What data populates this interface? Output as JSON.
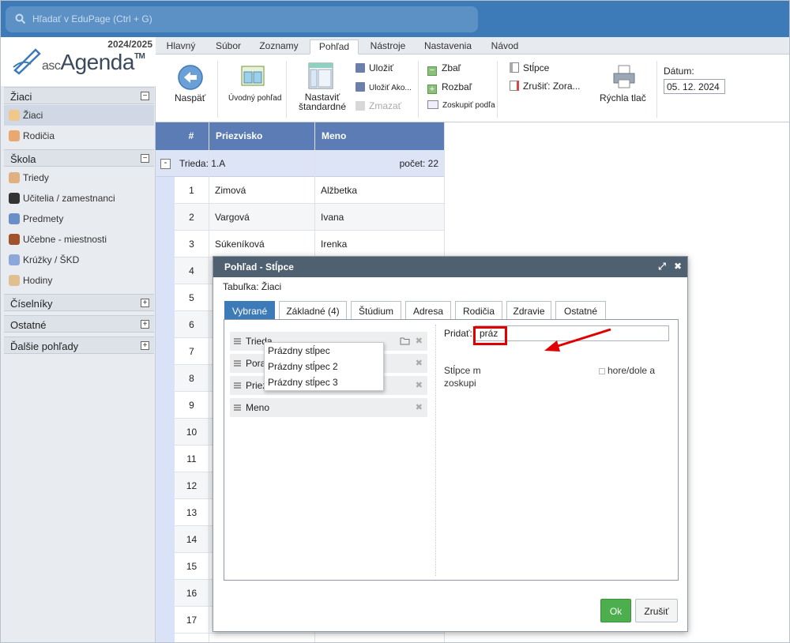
{
  "search": {
    "placeholder": "Hľadať v EduPage (Ctrl + G)"
  },
  "brand": {
    "year": "2024/2025",
    "prefix": "asc",
    "name": "Agenda",
    "tm": "TM"
  },
  "sidebar": {
    "sections": [
      {
        "label": "Žiaci",
        "toggle": "−"
      },
      {
        "label": "Škola",
        "toggle": "−"
      },
      {
        "label": "Číselníky",
        "toggle": "+"
      },
      {
        "label": "Ostatné",
        "toggle": "+"
      },
      {
        "label": "Ďalšie pohľady",
        "toggle": "+"
      }
    ],
    "items": [
      {
        "label": "Žiaci"
      },
      {
        "label": "Rodičia"
      },
      {
        "label": "Triedy"
      },
      {
        "label": "Učitelia / zamestnanci"
      },
      {
        "label": "Predmety"
      },
      {
        "label": "Učebne - miestnosti"
      },
      {
        "label": "Krúžky / ŠKD"
      },
      {
        "label": "Hodiny"
      }
    ]
  },
  "ribbon": {
    "tabs": [
      "Hlavný",
      "Súbor",
      "Zoznamy",
      "Pohľad",
      "Nástroje",
      "Nastavenia",
      "Návod"
    ],
    "back": "Naspäť",
    "intro_view": "Úvodný pohľad",
    "set_standard_1": "Nastaviť",
    "set_standard_2": "štandardné",
    "save": "Uložiť",
    "save_as": "Uložiť Ako...",
    "delete": "Zmazať",
    "collapse": "Zbaľ",
    "expand": "Rozbaľ",
    "group_by": "Zoskupiť podľa",
    "columns": "Stĺpce",
    "cancel_sort": "Zrušiť: Zora...",
    "quick_print": "Rýchla tlač",
    "date_label": "Dátum:",
    "date_value": "05. 12. 2024"
  },
  "grid": {
    "headers": {
      "num": "#",
      "surname": "Priezvisko",
      "name": "Meno"
    },
    "group": {
      "toggle": "-",
      "label": "Trieda: 1.A",
      "count": "počet: 22"
    },
    "rows": [
      {
        "num": "1",
        "surname": "Zimová",
        "name": "Alžbetka"
      },
      {
        "num": "2",
        "surname": "Vargová",
        "name": "Ivana"
      },
      {
        "num": "3",
        "surname": "Súkeníková",
        "name": "Irenka"
      },
      {
        "num": "4",
        "surname": "",
        "name": ""
      },
      {
        "num": "5",
        "surname": "",
        "name": ""
      },
      {
        "num": "6",
        "surname": "",
        "name": ""
      },
      {
        "num": "7",
        "surname": "",
        "name": ""
      },
      {
        "num": "8",
        "surname": "",
        "name": ""
      },
      {
        "num": "9",
        "surname": "",
        "name": ""
      },
      {
        "num": "10",
        "surname": "",
        "name": ""
      },
      {
        "num": "11",
        "surname": "",
        "name": ""
      },
      {
        "num": "12",
        "surname": "",
        "name": ""
      },
      {
        "num": "13",
        "surname": "",
        "name": ""
      },
      {
        "num": "14",
        "surname": "",
        "name": ""
      },
      {
        "num": "15",
        "surname": "",
        "name": ""
      },
      {
        "num": "16",
        "surname": "",
        "name": ""
      },
      {
        "num": "17",
        "surname": "",
        "name": ""
      }
    ]
  },
  "dialog": {
    "title": "Pohľad - Stĺpce",
    "subtitle": "Tabuľka: Žiaci",
    "tabs": [
      "Vybrané",
      "Základné (4)",
      "Štúdium",
      "Adresa",
      "Rodičia",
      "Zdravie",
      "Ostatné"
    ],
    "selected_columns": [
      "Trieda",
      "Poradové číslo",
      "Priezvisko",
      "Meno"
    ],
    "add_label": "Pridať:",
    "add_value": "práz",
    "hint_left_1": "Stĺpce m",
    "hint_left_2": "zoskupi",
    "hint_right_1": "hore/dole a",
    "suggestions": [
      "Prázdny stĺpec",
      "Prázdny stĺpec 2",
      "Prázdny stĺpec 3"
    ],
    "ok": "Ok",
    "cancel": "Zrušiť"
  },
  "colors": {
    "accent": "#3d7ab8",
    "grid_header": "#5b7cb5",
    "ok": "#4cae4c",
    "annotation": "#e00000"
  }
}
